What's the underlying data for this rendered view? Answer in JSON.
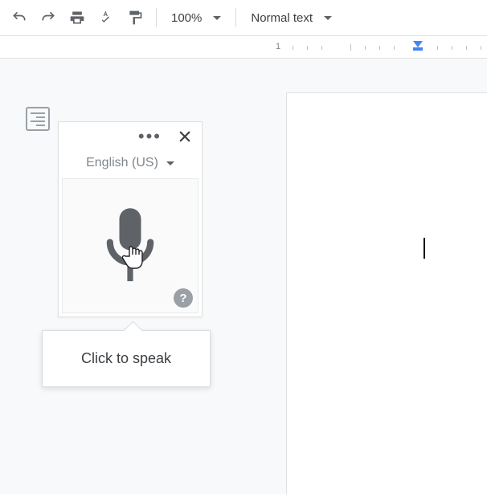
{
  "toolbar": {
    "zoom": "100%",
    "style": "Normal text"
  },
  "ruler": {
    "label_1": "1"
  },
  "voice": {
    "language": "English (US)",
    "tooltip": "Click to speak",
    "help": "?"
  }
}
